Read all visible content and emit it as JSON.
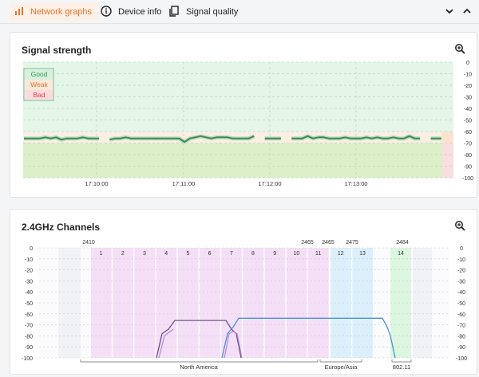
{
  "tabs": [
    {
      "label": "Network graphs",
      "active": true,
      "icon": "bar-chart-icon"
    },
    {
      "label": "Device info",
      "active": false,
      "icon": "info-icon"
    },
    {
      "label": "Signal quality",
      "active": false,
      "icon": "document-icon"
    }
  ],
  "colors": {
    "accent": "#e8742e",
    "good": "#2e9e4f",
    "weak": "#e8742e",
    "bad": "#e0404a",
    "north_america": "#f4dcf7",
    "europe_asia": "#d9eefb",
    "j802_11": "#dbf5df"
  },
  "signal_card": {
    "title": "Signal strength",
    "zoom_icon": "zoom-in-icon",
    "legend": {
      "good": "Good",
      "weak": "Weak",
      "bad": "Bad"
    }
  },
  "channels_card": {
    "title": "2.4GHz Channels",
    "zoom_icon": "zoom-in-icon",
    "freq_labels": [
      "2410",
      "2465",
      "2465",
      "2475",
      "2484"
    ],
    "region_labels": [
      "North America",
      "Europe/Asia",
      "802.11"
    ]
  },
  "chart_data": [
    {
      "type": "line",
      "title": "Signal strength",
      "x_ticks": [
        "17:10:00",
        "17:11:00",
        "17:12:00",
        "17:13:00"
      ],
      "y_ticks": [
        "0",
        "-10",
        "-20",
        "-30",
        "-40",
        "-50",
        "-60",
        "-70",
        "-80",
        "-90",
        "-100"
      ],
      "ylim": [
        -100,
        0
      ],
      "grid": true,
      "bands": [
        {
          "name": "Good",
          "from": -60,
          "to": 0
        },
        {
          "name": "Weak",
          "from": -70,
          "to": -60
        },
        {
          "name": "Bad",
          "from": -100,
          "to": -70
        }
      ],
      "series": [
        {
          "values": [
            -66,
            -66,
            -66,
            -66,
            -65,
            -66,
            -65,
            -67,
            -66,
            -66,
            -66,
            -65,
            -66,
            -66,
            -66,
            null,
            -67,
            -66,
            -66,
            -65,
            -66,
            -66,
            -66,
            -66,
            -66,
            -66,
            -66,
            -66,
            -66,
            -66,
            -69,
            -66,
            -65,
            -64,
            -65,
            -66,
            -65,
            -65,
            -65,
            -66,
            -66,
            -66,
            -66,
            -64,
            null,
            -66,
            -66,
            -66,
            -66,
            null,
            -66,
            -66,
            -66,
            -64,
            -66,
            -65,
            -65,
            -66,
            -66,
            -66,
            -65,
            -66,
            -66,
            -66,
            -65,
            -66,
            -65,
            -66,
            -66,
            -65,
            -66,
            -66,
            -64,
            -66,
            -66,
            null,
            -66,
            -66,
            -66
          ]
        }
      ]
    },
    {
      "type": "line",
      "title": "2.4GHz Channels",
      "categories": [
        "1",
        "2",
        "3",
        "4",
        "5",
        "6",
        "7",
        "8",
        "9",
        "10",
        "11",
        "12",
        "13",
        "14"
      ],
      "y_ticks": [
        "0",
        "-10",
        "-20",
        "-30",
        "-40",
        "-50",
        "-60",
        "-70",
        "-80",
        "-90",
        "-100"
      ],
      "ylim": [
        -100,
        0
      ],
      "grid": true,
      "regions": [
        {
          "label": "North America",
          "channels": [
            1,
            11
          ]
        },
        {
          "label": "Europe/Asia",
          "channels": [
            12,
            13
          ]
        },
        {
          "label": "802.11",
          "channels": [
            14,
            14
          ]
        }
      ],
      "series": [
        {
          "channel_span": [
            4,
            8
          ],
          "peak": -66,
          "floor": -100
        },
        {
          "channel_span": [
            8,
            14
          ],
          "peak": -64,
          "floor": -100
        },
        {
          "channel_span": [
            4,
            8
          ],
          "peak": -76,
          "floor": -100
        }
      ]
    }
  ]
}
